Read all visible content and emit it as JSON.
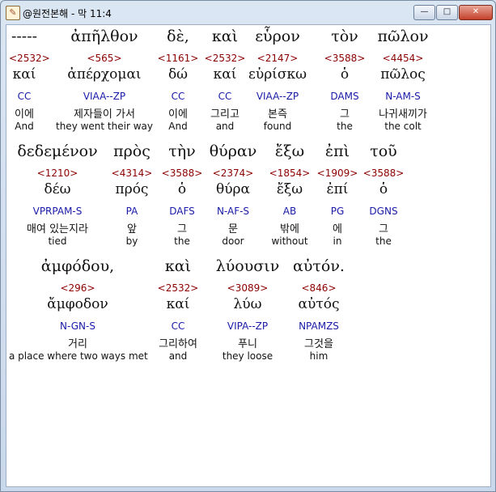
{
  "window": {
    "title": "@원전본해 - 막 11:4",
    "minimize": "—",
    "maximize": "□",
    "close": "✕"
  },
  "words": [
    {
      "greek": "-----",
      "strong": "<2532>",
      "lexeme": "καί",
      "parse": "CC",
      "korean": "이에",
      "english": "And"
    },
    {
      "greek": "ἀπῆλθον",
      "strong": "<565>",
      "lexeme": "ἀπέρχομαι",
      "parse": "VIAA--ZP",
      "korean": "제자들이 가서",
      "english": "they went their way"
    },
    {
      "greek": "δὲ,",
      "strong": "<1161>",
      "lexeme": "δώ",
      "parse": "CC",
      "korean": "이에",
      "english": "And"
    },
    {
      "greek": "καὶ",
      "strong": "<2532>",
      "lexeme": "καί",
      "parse": "CC",
      "korean": "그리고",
      "english": "and"
    },
    {
      "greek": "εὗρον",
      "strong": "<2147>",
      "lexeme": "εὑρίσκω",
      "parse": "VIAA--ZP",
      "korean": "본즉",
      "english": "found"
    },
    {
      "greek": "τὸν",
      "strong": "<3588>",
      "lexeme": "ὁ",
      "parse": "DAMS",
      "korean": "그",
      "english": "the"
    },
    {
      "greek": "πῶλον",
      "strong": "<4454>",
      "lexeme": "πῶλος",
      "parse": "N-AM-S",
      "korean": "나귀새끼가",
      "english": "the colt"
    },
    {
      "greek": "δεδεμένον",
      "strong": "<1210>",
      "lexeme": "δέω",
      "parse": "VPRPAM-S",
      "korean": "매여 있는지라",
      "english": "tied"
    },
    {
      "greek": "πρὸς",
      "strong": "<4314>",
      "lexeme": "πρός",
      "parse": "PA",
      "korean": "앞",
      "english": "by"
    },
    {
      "greek": "τὴν",
      "strong": "<3588>",
      "lexeme": "ὁ",
      "parse": "DAFS",
      "korean": "그",
      "english": "the"
    },
    {
      "greek": "θύραν",
      "strong": "<2374>",
      "lexeme": "θύρα",
      "parse": "N-AF-S",
      "korean": "문",
      "english": "door"
    },
    {
      "greek": "ἔξω",
      "strong": "<1854>",
      "lexeme": "ἔξω",
      "parse": "AB",
      "korean": "밖에",
      "english": "without"
    },
    {
      "greek": "ἐπὶ",
      "strong": "<1909>",
      "lexeme": "ἐπί",
      "parse": "PG",
      "korean": "에",
      "english": "in"
    },
    {
      "greek": "τοῦ",
      "strong": "<3588>",
      "lexeme": "ὁ",
      "parse": "DGNS",
      "korean": "그",
      "english": "the"
    },
    {
      "greek": "ἀμφόδου,",
      "strong": "<296>",
      "lexeme": "ἄμφοδον",
      "parse": "N-GN-S",
      "korean": "거리",
      "english": "a place where two ways met"
    },
    {
      "greek": "καὶ",
      "strong": "<2532>",
      "lexeme": "καί",
      "parse": "CC",
      "korean": "그리하여",
      "english": "and"
    },
    {
      "greek": "λύουσιν",
      "strong": "<3089>",
      "lexeme": "λύω",
      "parse": "VIPA--ZP",
      "korean": "푸니",
      "english": "they loose"
    },
    {
      "greek": "αὐτόν.",
      "strong": "<846>",
      "lexeme": "αὐτός",
      "parse": "NPAMZS",
      "korean": "그것을",
      "english": "him"
    }
  ]
}
